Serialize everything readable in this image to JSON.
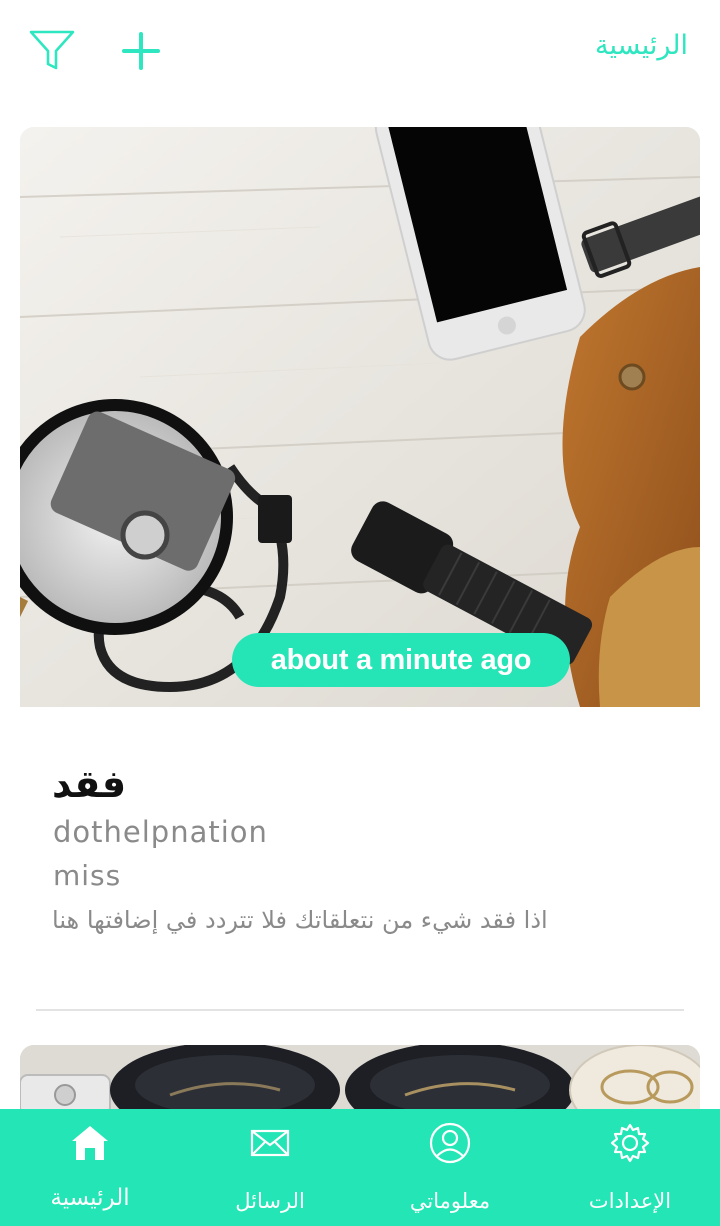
{
  "header": {
    "title": "الرئيسية",
    "filter_icon": "filter-icon",
    "add_icon": "plus-icon",
    "accent_color": "#2ee6c0"
  },
  "posts": [
    {
      "image": "photo-flatlay-lost-items",
      "time_ago": "about a minute ago",
      "title": "فقد",
      "username": "dothelpnation",
      "tag": "miss",
      "description": "اذا فقد شيء من نتعلقاتك فلا تتردد في إضافتها هنا"
    },
    {
      "image": "photo-glasses-cases"
    }
  ],
  "bottom_nav": {
    "background": "#23e5b6",
    "items": [
      {
        "label": "الإعدادات",
        "icon": "gear-icon"
      },
      {
        "label": "معلوماتي",
        "icon": "user-icon"
      },
      {
        "label": "الرسائل",
        "icon": "envelope-icon"
      },
      {
        "label": "الرئيسية",
        "icon": "home-icon",
        "active": true
      }
    ]
  }
}
